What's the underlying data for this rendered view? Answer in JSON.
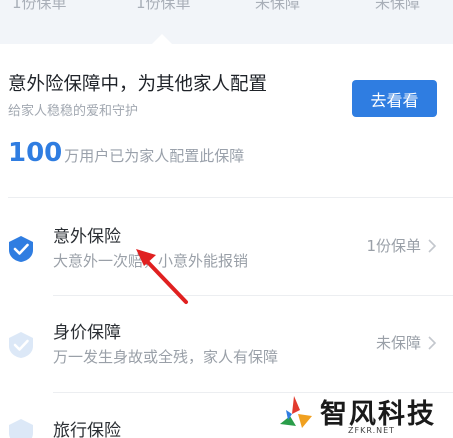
{
  "top_tabs": [
    {
      "label": "1份保单"
    },
    {
      "label": "1份保单"
    },
    {
      "label": "未保障"
    },
    {
      "label": "未保障"
    }
  ],
  "promo": {
    "title": "意外险保障中，为其他家人配置",
    "subtitle": "给家人稳稳的爱和守护",
    "button_label": "去看看",
    "stat_number": "100",
    "stat_text": "万用户已为家人配置此保障"
  },
  "items": [
    {
      "title": "意外保险",
      "desc": "大意外一次赔，小意外能报销",
      "status": "1份保单",
      "covered": true
    },
    {
      "title": "身价保障",
      "desc": "万一发生身故或全残，家人有保障",
      "status": "未保障",
      "covered": false
    },
    {
      "title": "旅行保险",
      "desc": "",
      "status": "",
      "covered": false
    }
  ],
  "watermark": {
    "text": "智风科技",
    "sub": "ZFKR.NET"
  },
  "colors": {
    "accent": "#2f7de1",
    "check_active": "#2f7de1",
    "check_inactive": "#dce8f7",
    "annotation_arrow": "#e02020"
  }
}
